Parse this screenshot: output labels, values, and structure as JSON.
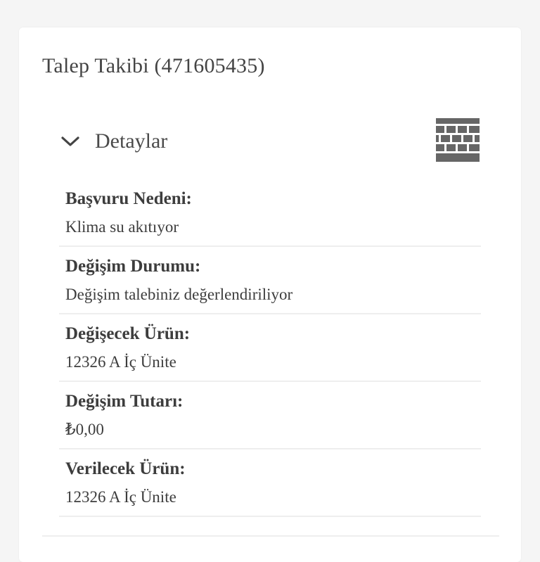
{
  "page": {
    "title": "Talep Takibi (471605435)"
  },
  "details": {
    "toggle_label": "Detaylar",
    "toggle_icon": "chevron-down-icon",
    "view_icon": "table-icon",
    "rows": [
      {
        "label": "Başvuru Nedeni:",
        "value": "Klima su akıtıyor"
      },
      {
        "label": "Değişim Durumu:",
        "value": "Değişim talebiniz değerlendiriliyor"
      },
      {
        "label": "Değişecek Ürün:",
        "value": "12326 A İç Ünite"
      },
      {
        "label": "Değişim Tutarı:",
        "value": "₺0,00"
      },
      {
        "label": "Verilecek Ürün:",
        "value": "12326 A İç Ünite"
      }
    ]
  },
  "colors": {
    "background": "#f5f5f5",
    "card": "#ffffff",
    "text": "#3d3d3d",
    "icon": "#666666",
    "divider": "#eeeeee"
  }
}
